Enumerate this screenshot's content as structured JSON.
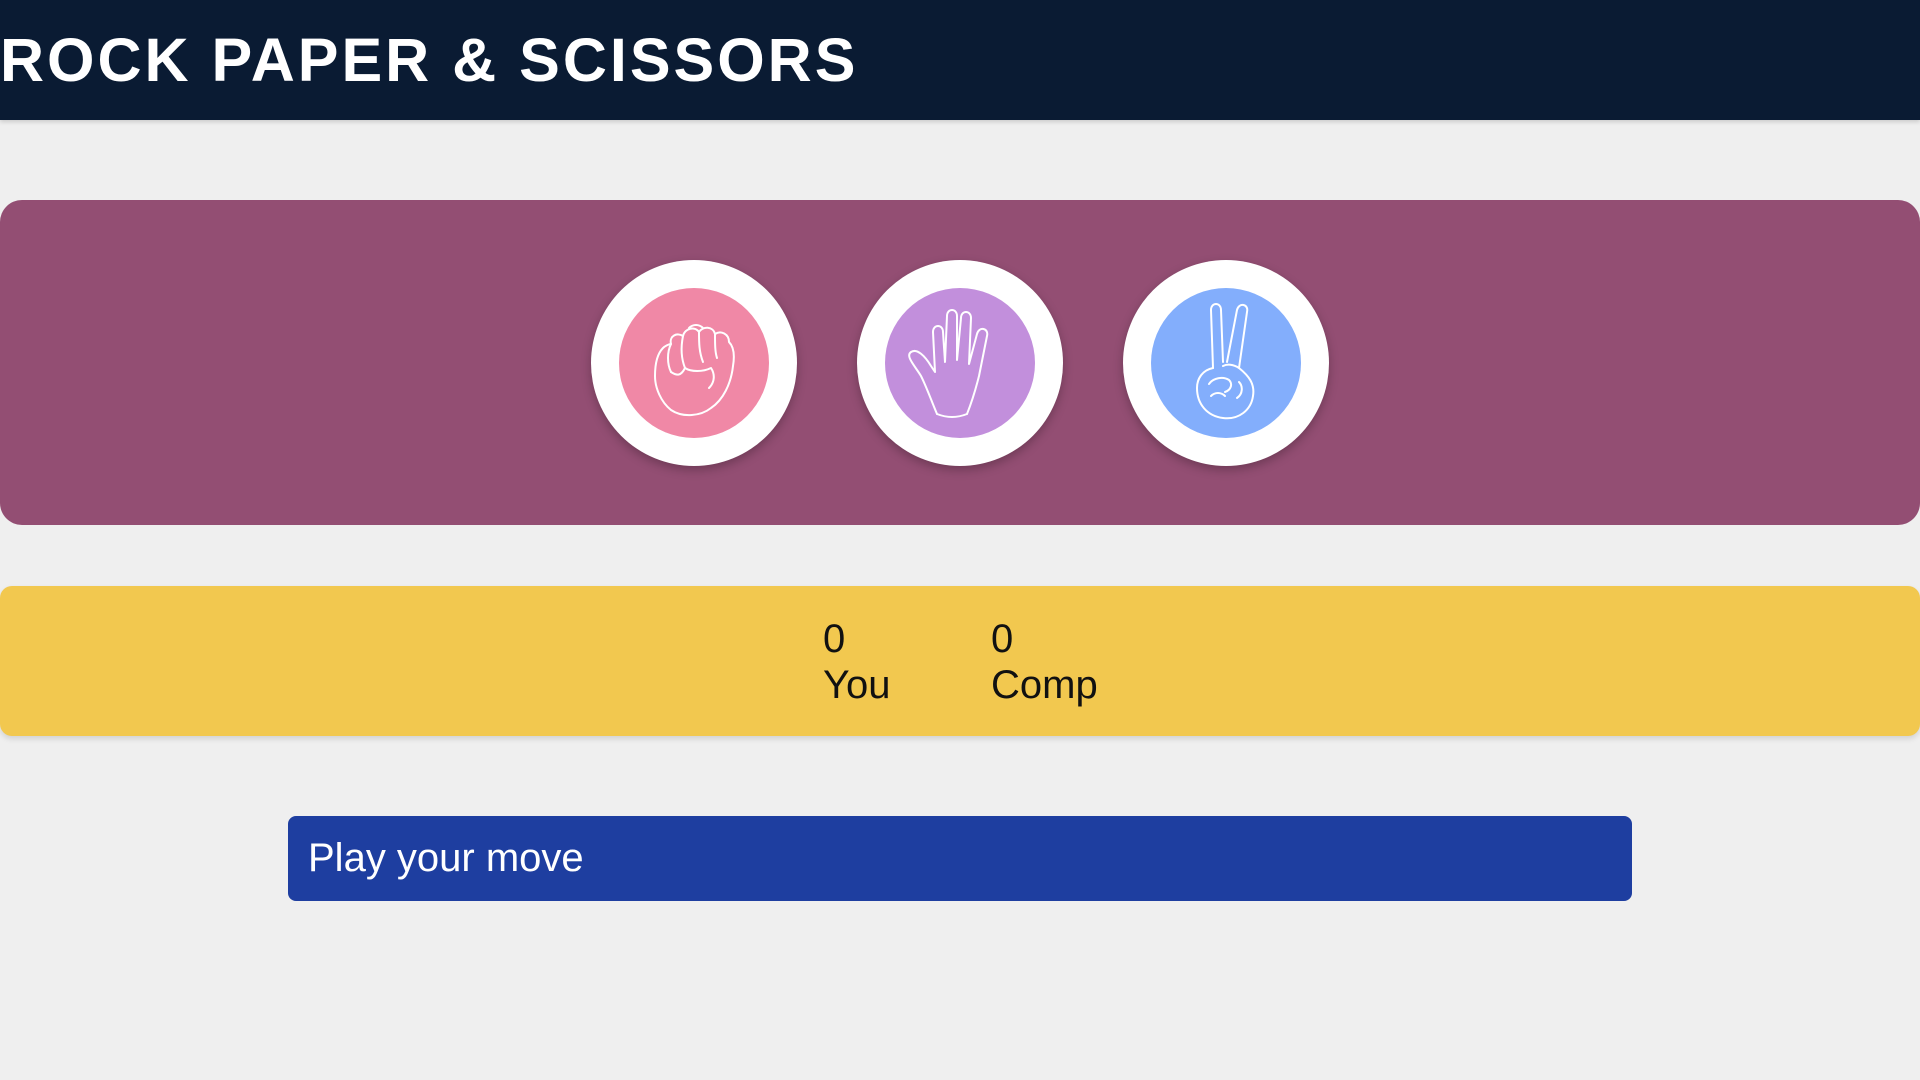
{
  "header": {
    "title": "ROCK PAPER & SCISSORS"
  },
  "choices": [
    {
      "label": "rock",
      "icon": "fist-icon",
      "color": "#f088a6"
    },
    {
      "label": "paper",
      "icon": "open-hand-icon",
      "color": "#c28fdc"
    },
    {
      "label": "scissors",
      "icon": "peace-hand-icon",
      "color": "#83aefc"
    }
  ],
  "scoreboard": {
    "user_score": "0",
    "user_label": "You",
    "comp_score": "0",
    "comp_label": "Comp"
  },
  "message": {
    "text": "Play your move"
  },
  "colors": {
    "header_bg": "#0a1b33",
    "choices_bg": "#934e73",
    "score_bg": "#f2c84f",
    "message_bg": "#1e3ea0",
    "page_bg": "#efefef"
  }
}
